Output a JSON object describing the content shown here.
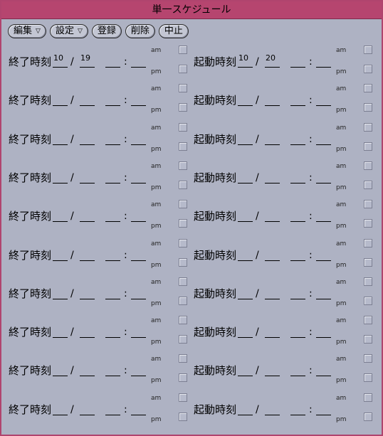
{
  "window": {
    "title": "単一スケジュール"
  },
  "toolbar": {
    "edit_label": "編集",
    "settings_label": "設定",
    "register_label": "登録",
    "delete_label": "削除",
    "cancel_label": "中止",
    "menu_indicator": "▽"
  },
  "labels": {
    "end_time": "終了時刻",
    "start_time": "起動時刻",
    "date_sep": "/",
    "time_sep": ":",
    "am": "am",
    "pm": "pm"
  },
  "rows": [
    {
      "end": {
        "month": "10",
        "day": "19",
        "hour": "",
        "minute": "",
        "am": false,
        "pm": false
      },
      "start": {
        "month": "10",
        "day": "20",
        "hour": "",
        "minute": "",
        "am": false,
        "pm": false
      }
    },
    {
      "end": {
        "month": "",
        "day": "",
        "hour": "",
        "minute": "",
        "am": false,
        "pm": false
      },
      "start": {
        "month": "",
        "day": "",
        "hour": "",
        "minute": "",
        "am": false,
        "pm": false
      }
    },
    {
      "end": {
        "month": "",
        "day": "",
        "hour": "",
        "minute": "",
        "am": false,
        "pm": false
      },
      "start": {
        "month": "",
        "day": "",
        "hour": "",
        "minute": "",
        "am": false,
        "pm": false
      }
    },
    {
      "end": {
        "month": "",
        "day": "",
        "hour": "",
        "minute": "",
        "am": false,
        "pm": false
      },
      "start": {
        "month": "",
        "day": "",
        "hour": "",
        "minute": "",
        "am": false,
        "pm": false
      }
    },
    {
      "end": {
        "month": "",
        "day": "",
        "hour": "",
        "minute": "",
        "am": false,
        "pm": false
      },
      "start": {
        "month": "",
        "day": "",
        "hour": "",
        "minute": "",
        "am": false,
        "pm": false
      }
    },
    {
      "end": {
        "month": "",
        "day": "",
        "hour": "",
        "minute": "",
        "am": false,
        "pm": false
      },
      "start": {
        "month": "",
        "day": "",
        "hour": "",
        "minute": "",
        "am": false,
        "pm": false
      }
    },
    {
      "end": {
        "month": "",
        "day": "",
        "hour": "",
        "minute": "",
        "am": false,
        "pm": false
      },
      "start": {
        "month": "",
        "day": "",
        "hour": "",
        "minute": "",
        "am": false,
        "pm": false
      }
    },
    {
      "end": {
        "month": "",
        "day": "",
        "hour": "",
        "minute": "",
        "am": false,
        "pm": false
      },
      "start": {
        "month": "",
        "day": "",
        "hour": "",
        "minute": "",
        "am": false,
        "pm": false
      }
    },
    {
      "end": {
        "month": "",
        "day": "",
        "hour": "",
        "minute": "",
        "am": false,
        "pm": false
      },
      "start": {
        "month": "",
        "day": "",
        "hour": "",
        "minute": "",
        "am": false,
        "pm": false
      }
    },
    {
      "end": {
        "month": "",
        "day": "",
        "hour": "",
        "minute": "",
        "am": false,
        "pm": false
      },
      "start": {
        "month": "",
        "day": "",
        "hour": "",
        "minute": "",
        "am": false,
        "pm": false
      }
    }
  ]
}
